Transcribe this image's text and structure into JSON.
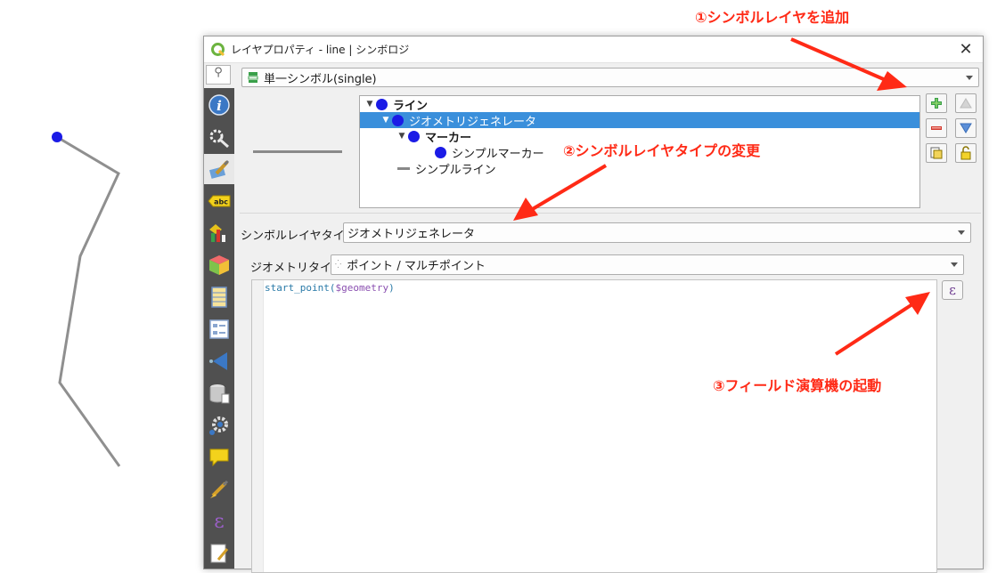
{
  "window": {
    "title": "レイヤプロパティ - line | シンボロジ",
    "close_label": "✕"
  },
  "search": {
    "icon": "search-icon",
    "glyph": "⚲"
  },
  "sidebar": {
    "items": [
      {
        "name": "information",
        "icon": "info-icon"
      },
      {
        "name": "source",
        "icon": "settings-icon"
      },
      {
        "name": "symbology",
        "icon": "paintbrush-icon",
        "active": true
      },
      {
        "name": "labels",
        "icon": "abc-label-icon",
        "label": "abc"
      },
      {
        "name": "diagrams",
        "icon": "diagram-icon"
      },
      {
        "name": "3d-view",
        "icon": "cube-icon"
      },
      {
        "name": "fields",
        "icon": "fields-icon"
      },
      {
        "name": "attributes-form",
        "icon": "form-icon"
      },
      {
        "name": "joins",
        "icon": "join-icon"
      },
      {
        "name": "auxiliary-storage",
        "icon": "database-icon"
      },
      {
        "name": "actions",
        "icon": "gear-icon"
      },
      {
        "name": "display",
        "icon": "speech-bubble-icon"
      },
      {
        "name": "rendering",
        "icon": "brush-icon"
      },
      {
        "name": "variables",
        "icon": "epsilon-icon",
        "label": "ε"
      },
      {
        "name": "metadata",
        "icon": "document-edit-icon"
      }
    ]
  },
  "renderer": {
    "value": "単一シンボル(single)"
  },
  "symbol_tree": {
    "items": [
      {
        "label": "ライン",
        "level": 0,
        "marker": "dot",
        "bold": true,
        "selected": false
      },
      {
        "label": "ジオメトリジェネレータ",
        "level": 1,
        "marker": "dot",
        "bold": false,
        "selected": true
      },
      {
        "label": "マーカー",
        "level": 2,
        "marker": "dot",
        "bold": true,
        "selected": false
      },
      {
        "label": "シンプルマーカー",
        "level": 3,
        "marker": "dot",
        "bold": false,
        "selected": false
      },
      {
        "label": "シンプルライン",
        "level": 2,
        "marker": "dash",
        "bold": false,
        "selected": false
      }
    ]
  },
  "layer_buttons": {
    "add": "add-layer-icon",
    "remove": "remove-layer-icon",
    "duplicate": "duplicate-icon",
    "move_up": "arrow-up-icon",
    "move_down": "arrow-down-icon",
    "lock": "lock-icon"
  },
  "symbol_layer_type": {
    "label": "シンボルレイヤタイプ",
    "value": "ジオメトリジェネレータ"
  },
  "geometry_type": {
    "label": "ジオメトリタイプ",
    "value": "ポイント / マルチポイント"
  },
  "expression": {
    "func": "start_point(",
    "var": "$geometry",
    "close": ")",
    "button_label": "ε"
  },
  "annotations": {
    "a1": "①シンボルレイヤを追加",
    "a2": "②シンボルレイヤタイプの変更",
    "a3": "③フィールド演算機の起動"
  },
  "colors": {
    "annotation": "#ff2a16",
    "selection": "#3a8fdb",
    "marker": "#1b1be6",
    "sidebar": "#505050"
  }
}
